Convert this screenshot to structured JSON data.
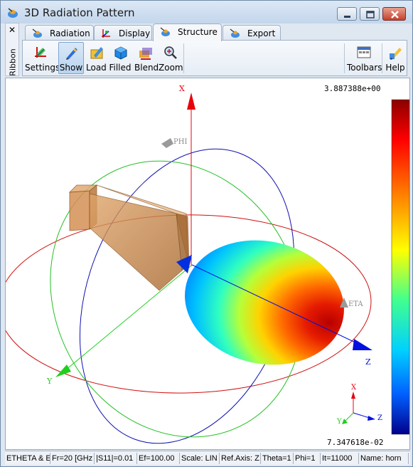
{
  "window": {
    "title": "3D Radiation Pattern",
    "controls": [
      "minimize",
      "maximize",
      "close"
    ]
  },
  "ribbon": {
    "close_glyph": "✕",
    "side_label": "Ribbon",
    "tabs": [
      {
        "label": "Radiation",
        "icon": "radiation-tab-icon",
        "active": false
      },
      {
        "label": "Display",
        "icon": "display-tab-icon",
        "active": false
      },
      {
        "label": "Structure",
        "icon": "structure-tab-icon",
        "active": true
      },
      {
        "label": "Export",
        "icon": "export-tab-icon",
        "active": false
      }
    ],
    "buttons": [
      {
        "label": "Settings",
        "icon": "settings-icon",
        "pressed": false
      },
      {
        "label": "Show",
        "icon": "show-icon",
        "pressed": true
      },
      {
        "label": "Load",
        "icon": "load-icon",
        "pressed": false
      },
      {
        "label": "Filled",
        "icon": "cube-icon",
        "pressed": false
      },
      {
        "label": "Blend",
        "icon": "blend-icon",
        "pressed": false
      },
      {
        "label": "Zoom",
        "icon": "zoom-icon",
        "pressed": false
      },
      {
        "label": "Toolbars",
        "icon": "toolbars-icon",
        "pressed": false
      },
      {
        "label": "Help",
        "icon": "help-icon",
        "pressed": false
      }
    ]
  },
  "viewport": {
    "colorbar_max": "3.887388e+00",
    "colorbar_min": "7.347618e-02",
    "axis_labels": {
      "x": "X",
      "y": "Y",
      "z": "Z",
      "phi": "PHI",
      "theta": "ETA"
    },
    "triad_labels": {
      "x": "X",
      "y": "Y",
      "z": "Z"
    },
    "colors": {
      "x_axis": "#e8000b",
      "y_axis": "#1fcf1f",
      "z_axis": "#0010e0",
      "circle_red": "#d01010",
      "circle_green": "#22c022",
      "circle_blue": "#1010b0",
      "horn": "#c98a4e"
    }
  },
  "statusbar": {
    "cells": [
      "ETHETA & E",
      "Fr=20 [GHz",
      "|S11|=0.01",
      "Ef=100.00",
      "Scale: LIN",
      "Ref.Axis: Z",
      "Theta=1",
      "Phi=1",
      "It=11000",
      "Name: horn"
    ]
  }
}
